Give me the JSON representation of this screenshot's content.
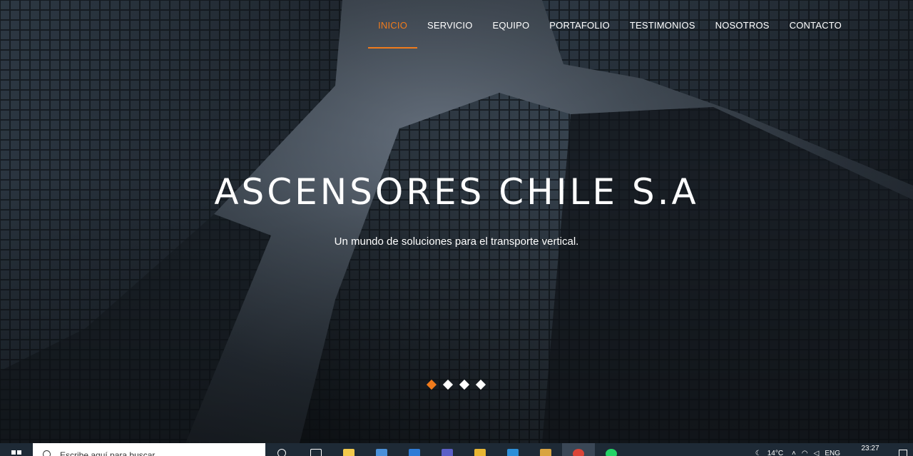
{
  "nav": {
    "items": [
      {
        "label": "INICIO",
        "active": true
      },
      {
        "label": "SERVICIO",
        "active": false
      },
      {
        "label": "EQUIPO",
        "active": false
      },
      {
        "label": "PORTAFOLIO",
        "active": false
      },
      {
        "label": "TESTIMONIOS",
        "active": false
      },
      {
        "label": "NOSOTROS",
        "active": false
      },
      {
        "label": "CONTACTO",
        "active": false
      }
    ]
  },
  "hero": {
    "title": "ASCENSORES CHILE S.A",
    "subtitle": "Un mundo de soluciones para el transporte vertical.",
    "slide_count": 4,
    "active_slide": 1
  },
  "taskbar": {
    "search_placeholder": "Escribe aquí para buscar",
    "apps": [
      "search-icon",
      "task-view-icon",
      "file-explorer-icon",
      "store-icon",
      "mail-icon",
      "teams-icon",
      "folder-icon",
      "vscode-icon",
      "app-icon",
      "chrome-icon",
      "whatsapp-icon"
    ],
    "weather": "14°C",
    "language": "ENG",
    "time": "23:27"
  },
  "colors": {
    "accent": "#f07b1c",
    "text": "#ffffff",
    "taskbar": "#1e2a36"
  }
}
